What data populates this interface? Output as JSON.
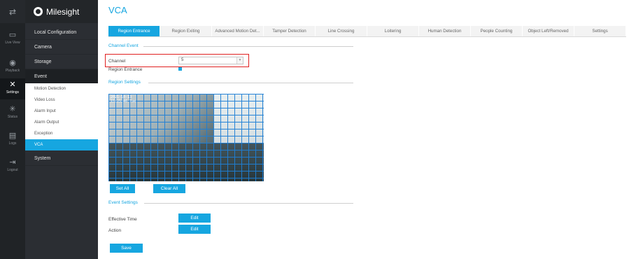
{
  "app": {
    "brand": "Milesight",
    "page_title": "VCA"
  },
  "rail": {
    "items": [
      {
        "label": "Live View",
        "icon": "live-view-icon",
        "glyph": "▭"
      },
      {
        "label": "Playback",
        "icon": "playback-icon",
        "glyph": "◉"
      },
      {
        "label": "Settings",
        "icon": "settings-icon",
        "glyph": "✕"
      },
      {
        "label": "Status",
        "icon": "status-icon",
        "glyph": "✳"
      },
      {
        "label": "Logs",
        "icon": "logs-icon",
        "glyph": "▤"
      },
      {
        "label": "Logout",
        "icon": "logout-icon",
        "glyph": "⇥"
      }
    ],
    "active": "Settings"
  },
  "menu": {
    "items": [
      "Local Configuration",
      "Camera",
      "Storage",
      "Event",
      "System"
    ],
    "event_sub": [
      "Motion Detection",
      "Video Loss",
      "Alarm Input",
      "Alarm Output",
      "Exception",
      "VCA"
    ],
    "active_sub": "VCA"
  },
  "tabs": [
    "Region Entrance",
    "Region Exiting",
    "Advanced Motion Det...",
    "Tamper Detection",
    "Line Crossing",
    "Loitering",
    "Human Detection",
    "People Counting",
    "Object Left/Removed",
    "Settings"
  ],
  "active_tab": "Region Entrance",
  "channel_event": {
    "section_title": "Channel Event",
    "channel_label": "Channel",
    "channel_value": "5",
    "region_entrance_label": "Region Entrance",
    "region_entrance_checked": true
  },
  "region_settings": {
    "section_title": "Region Settings",
    "osd_text": "2021-10-13\n15:25:46 Tue",
    "set_all": "Set All",
    "clear_all": "Clear All"
  },
  "event_settings": {
    "section_title": "Event Settings",
    "effective_time_label": "Effective Time",
    "action_label": "Action",
    "edit_label": "Edit"
  },
  "save_label": "Save",
  "colors": {
    "accent": "#16a6e0",
    "highlight": "#e02020",
    "rail_bg": "#202326",
    "menu_bg": "#2b2e33"
  }
}
